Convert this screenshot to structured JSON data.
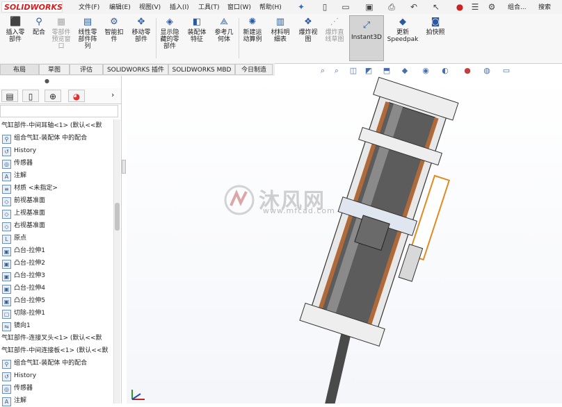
{
  "app": {
    "logo": "SOLIDWORKS"
  },
  "menu": [
    "文件(F)",
    "编辑(E)",
    "视图(V)",
    "插入(I)",
    "工具(T)",
    "窗口(W)",
    "帮助(H)"
  ],
  "quick_access": {
    "assembly_label": "组合...",
    "search_label": "搜索"
  },
  "command_manager": {
    "items": [
      {
        "label": "插入零\n部件",
        "icon": "insert-component-icon",
        "enabled": true
      },
      {
        "label": "配合",
        "icon": "mate-icon",
        "enabled": true
      },
      {
        "label": "零部件\n预览窗\n口",
        "icon": "preview-icon",
        "enabled": false
      },
      {
        "label": "线性零\n部件阵\n列",
        "icon": "pattern-icon",
        "enabled": true
      },
      {
        "label": "智能扣\n件",
        "icon": "fastener-icon",
        "enabled": true
      },
      {
        "label": "移动零\n部件",
        "icon": "move-icon",
        "enabled": true
      },
      {
        "label": "显示隐\n藏的零\n部件",
        "icon": "show-hidden-icon",
        "enabled": true
      },
      {
        "label": "装配体\n特征",
        "icon": "assembly-feature-icon",
        "enabled": true
      },
      {
        "label": "参考几\n何体",
        "icon": "reference-geometry-icon",
        "enabled": true
      },
      {
        "label": "新建运\n动算例",
        "icon": "motion-study-icon",
        "enabled": true
      },
      {
        "label": "材料明\n细表",
        "icon": "bom-icon",
        "enabled": true
      },
      {
        "label": "爆炸视\n图",
        "icon": "explode-icon",
        "enabled": true
      },
      {
        "label": "爆炸直\n线草图",
        "icon": "explode-line-icon",
        "enabled": false
      }
    ],
    "instant3d": "Instant3D",
    "speedpak": "更新\nSpeedpak",
    "snapshot": "拍快照"
  },
  "tabs": [
    "布局",
    "草图",
    "评估",
    "SOLIDWORKS 插件",
    "SOLIDWORKS MBD",
    "今日制造"
  ],
  "feature_tree": [
    {
      "label": "气缸部件-中间耳轴<1> (默认<<默",
      "icon": "",
      "indent": 0
    },
    {
      "label": "组合气缸-装配体 中的配合",
      "icon": "mate-folder-icon",
      "indent": 1
    },
    {
      "label": "History",
      "icon": "history-icon",
      "indent": 1
    },
    {
      "label": "传感器",
      "icon": "sensor-icon",
      "indent": 1
    },
    {
      "label": "注解",
      "icon": "annotation-icon",
      "indent": 1
    },
    {
      "label": "材质 <未指定>",
      "icon": "material-icon",
      "indent": 1
    },
    {
      "label": "前视基准面",
      "icon": "plane-icon",
      "indent": 1
    },
    {
      "label": "上视基准面",
      "icon": "plane-icon",
      "indent": 1
    },
    {
      "label": "右视基准面",
      "icon": "plane-icon",
      "indent": 1
    },
    {
      "label": "原点",
      "icon": "origin-icon",
      "indent": 1
    },
    {
      "label": "凸台-拉伸1",
      "icon": "extrude-icon",
      "indent": 1
    },
    {
      "label": "凸台-拉伸2",
      "icon": "extrude-icon",
      "indent": 1
    },
    {
      "label": "凸台-拉伸3",
      "icon": "extrude-icon",
      "indent": 1
    },
    {
      "label": "凸台-拉伸4",
      "icon": "extrude-icon",
      "indent": 1
    },
    {
      "label": "凸台-拉伸5",
      "icon": "extrude-icon",
      "indent": 1
    },
    {
      "label": "切除-拉伸1",
      "icon": "cut-icon",
      "indent": 1
    },
    {
      "label": "镜向1",
      "icon": "mirror-icon",
      "indent": 1
    },
    {
      "label": "气缸部件-连接叉头<1> (默认<<默",
      "icon": "",
      "indent": 0
    },
    {
      "label": "气缸部件-中间连接板<1> (默认<<默",
      "icon": "",
      "indent": 0
    },
    {
      "label": "组合气缸-装配体 中的配合",
      "icon": "mate-folder-icon",
      "indent": 1
    },
    {
      "label": "History",
      "icon": "history-icon",
      "indent": 1
    },
    {
      "label": "传感器",
      "icon": "sensor-icon",
      "indent": 1
    },
    {
      "label": "注解",
      "icon": "annotation-icon",
      "indent": 1
    }
  ],
  "watermark": {
    "text": "沐风网",
    "url": "www.mfcad.com"
  },
  "triad": {
    "y_label": "Y"
  }
}
